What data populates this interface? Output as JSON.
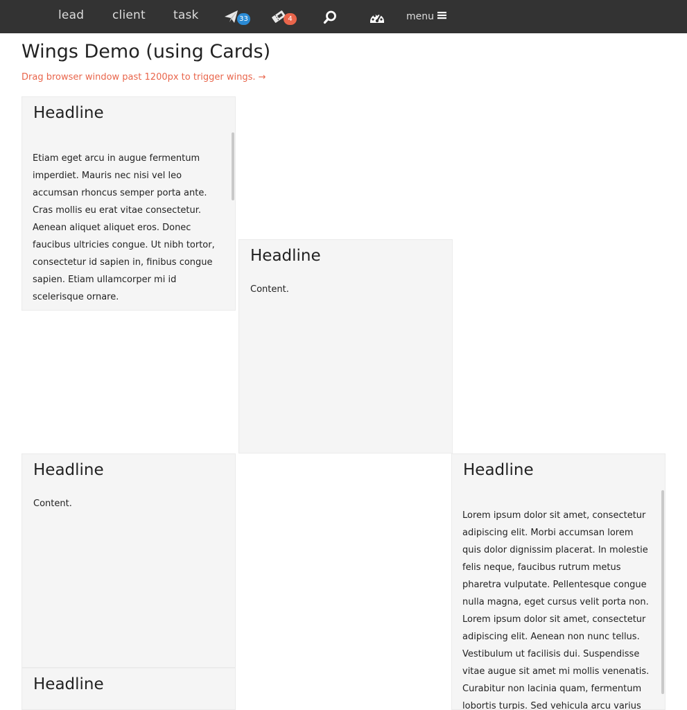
{
  "nav": {
    "links": [
      "lead",
      "client",
      "task"
    ],
    "send_badge": "33",
    "ticket_badge": "4",
    "menu_label": "menu",
    "icons": [
      "paper-plane-icon",
      "ticket-icon",
      "search-icon",
      "dashboard-gauge-icon",
      "hamburger-icon"
    ],
    "colors": {
      "bar": "#333333",
      "badge_blue": "#2a8ad4",
      "badge_red": "#e9654b"
    }
  },
  "page": {
    "title": "Wings Demo (using Cards)",
    "subtitle": "Drag browser window past 1200px to trigger wings. →",
    "subtitle_color": "#e9654b"
  },
  "cards": [
    {
      "headline": "Headline",
      "content": "Etiam eget arcu in augue fermentum imperdiet. Mauris nec nisi vel leo accumsan rhoncus semper porta ante. Cras mollis eu erat vitae consectetur. Aenean aliquet aliquet eros. Donec faucibus ultricies congue. Ut nibh tortor, consectetur id sapien in, finibus congue sapien. Etiam ullamcorper mi id scelerisque ornare."
    },
    {
      "headline": "Headline",
      "content": "Content."
    },
    {
      "headline": "Headline",
      "content": "Content."
    },
    {
      "headline": "Headline",
      "content": "Lorem ipsum dolor sit amet, consectetur adipiscing elit. Morbi accumsan lorem quis dolor dignissim placerat. In molestie felis neque, faucibus rutrum metus pharetra vulputate. Pellentesque congue nulla magna, eget cursus velit porta non. Lorem ipsum dolor sit amet, consectetur adipiscing elit. Aenean non nunc tellus. Vestibulum ut facilisis dui. Suspendisse vitae augue sit amet mi mollis venenatis. Curabitur non lacinia quam, fermentum lobortis turpis. Sed vehicula arcu varius"
    },
    {
      "headline": "Headline"
    }
  ]
}
